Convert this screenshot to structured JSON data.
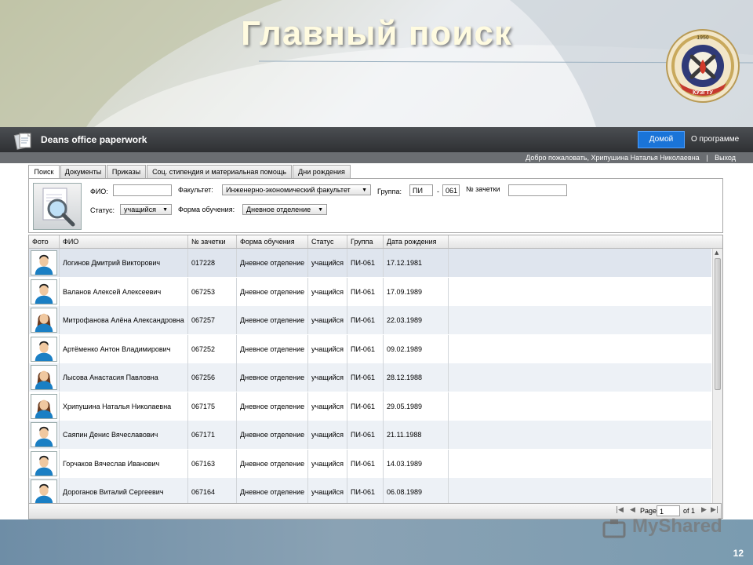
{
  "slide": {
    "title": "Главный поиск",
    "number": "12",
    "watermark": "MyShared",
    "emblem_year": "1950",
    "emblem_text": "КУЗГТУ"
  },
  "app": {
    "title": "Deans office paperwork",
    "nav": {
      "home": "Домой",
      "about": "О программе"
    },
    "welcome": "Добро пожаловать, Хрипушина Наталья Николаевна",
    "separator": "|",
    "logout": "Выход"
  },
  "tabs": [
    {
      "label": "Поиск"
    },
    {
      "label": "Документы"
    },
    {
      "label": "Приказы"
    },
    {
      "label": "Соц. стипендия и материальная помощь"
    },
    {
      "label": "Дни рождения"
    }
  ],
  "search": {
    "fio_label": "ФИО:",
    "fio_value": "",
    "faculty_label": "Факультет:",
    "faculty_value": "Инженерно-экономический факультет",
    "group_label": "Группа:",
    "group_prefix": "ПИ",
    "group_dash": "-",
    "group_number": "061",
    "record_label": "№ зачетки",
    "record_value": "",
    "status_label": "Статус:",
    "status_value": "учащийся",
    "form_label": "Форма обучения:",
    "form_value": "Дневное отделение"
  },
  "grid": {
    "columns": [
      "Фото",
      "ФИО",
      "№ зачетки",
      "Форма обучения",
      "Статус",
      "Группа",
      "Дата рождения"
    ],
    "rows": [
      {
        "fio": "Логинов Дмитрий Викторович",
        "record": "017228",
        "form": "Дневное отделение",
        "status": "учащийся",
        "group": "ПИ-061",
        "birth": "17.12.1981",
        "gender": "male"
      },
      {
        "fio": "Валанов Алексей Алексеевич",
        "record": "067253",
        "form": "Дневное отделение",
        "status": "учащийся",
        "group": "ПИ-061",
        "birth": "17.09.1989",
        "gender": "male"
      },
      {
        "fio": "Митрофанова Алёна Александровна",
        "record": "067257",
        "form": "Дневное отделение",
        "status": "учащийся",
        "group": "ПИ-061",
        "birth": "22.03.1989",
        "gender": "female"
      },
      {
        "fio": "Артёменко Антон Владимирович",
        "record": "067252",
        "form": "Дневное отделение",
        "status": "учащийся",
        "group": "ПИ-061",
        "birth": "09.02.1989",
        "gender": "male"
      },
      {
        "fio": "Лысова Анастасия Павловна",
        "record": "067256",
        "form": "Дневное отделение",
        "status": "учащийся",
        "group": "ПИ-061",
        "birth": "28.12.1988",
        "gender": "female"
      },
      {
        "fio": "Хрипушина Наталья Николаевна",
        "record": "067175",
        "form": "Дневное отделение",
        "status": "учащийся",
        "group": "ПИ-061",
        "birth": "29.05.1989",
        "gender": "female"
      },
      {
        "fio": "Саяпин Денис Вячеславович",
        "record": "067171",
        "form": "Дневное отделение",
        "status": "учащийся",
        "group": "ПИ-061",
        "birth": "21.11.1988",
        "gender": "male"
      },
      {
        "fio": "Горчаков Вячеслав Иванович",
        "record": "067163",
        "form": "Дневное отделение",
        "status": "учащийся",
        "group": "ПИ-061",
        "birth": "14.03.1989",
        "gender": "male"
      },
      {
        "fio": "Дороганов Виталий Сергеевич",
        "record": "067164",
        "form": "Дневное отделение",
        "status": "учащийся",
        "group": "ПИ-061",
        "birth": "06.08.1989",
        "gender": "male"
      }
    ]
  },
  "pager": {
    "page_label": "Page",
    "page_value": "1",
    "of_label": "of 1"
  },
  "colors": {
    "accent": "#1a74d8",
    "header": "#3a3c3f",
    "title": "#fffbe0"
  }
}
